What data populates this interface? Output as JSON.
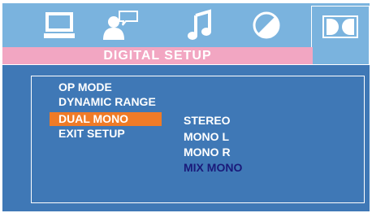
{
  "colors": {
    "screen_background": "#3f78b6",
    "tab_bar": "#7ab3de",
    "banner": "#f2a6c2",
    "highlight": "#f07b27",
    "selected_option_text": "#1a1a7a",
    "text": "#ffffff"
  },
  "tabs": [
    {
      "icon": "monitor-icon"
    },
    {
      "icon": "person-speech-icon"
    },
    {
      "icon": "music-note-icon"
    },
    {
      "icon": "contrast-circle-icon"
    },
    {
      "icon": "dolby-digital-icon",
      "selected": true
    }
  ],
  "banner": {
    "title": "DIGITAL  SETUP"
  },
  "menu": {
    "items": [
      "OP MODE",
      "DYNAMIC RANGE",
      "DUAL MONO",
      "EXIT SETUP"
    ],
    "highlighted": "DUAL MONO"
  },
  "options": {
    "items": [
      "STEREO",
      "MONO L",
      "MONO R",
      "MIX MONO"
    ],
    "selected": "MIX MONO"
  }
}
